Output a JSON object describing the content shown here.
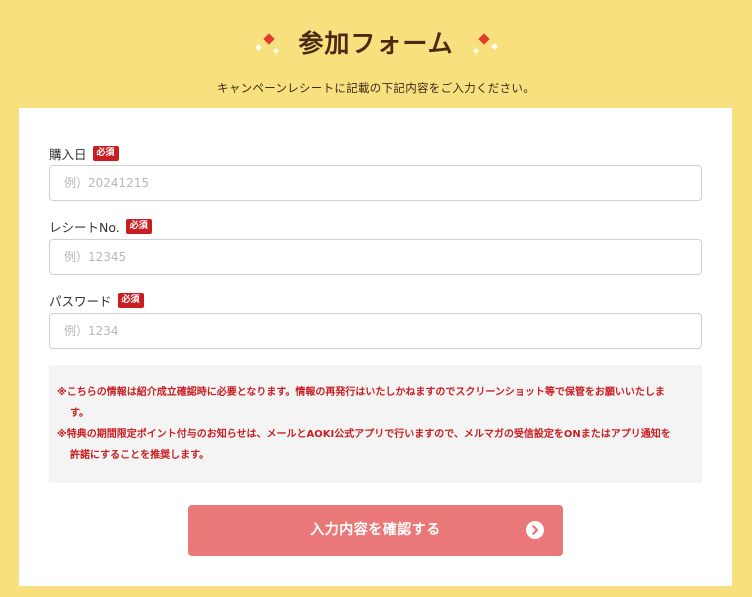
{
  "header": {
    "title": "参加フォーム",
    "subtitle": "キャンペーンレシートに記載の下記内容をご入力ください。"
  },
  "form": {
    "required_badge": "必須",
    "fields": [
      {
        "label": "購入日",
        "placeholder": "例）20241215",
        "value": ""
      },
      {
        "label": "レシートNo.",
        "placeholder": "例）12345",
        "value": ""
      },
      {
        "label": "パスワード",
        "placeholder": "例）1234",
        "value": ""
      }
    ],
    "notes": [
      "※こちらの情報は紹介成立確認時に必要となります。情報の再発行はいたしかねますのでスクリーンショット等で保管をお願いいたします。",
      "※特典の期間限定ポイント付与のお知らせは、メールとAOKI公式アプリで行いますので、メルマガの受信設定をONまたはアプリ通知を許諾にすることを推奨します。"
    ],
    "submit_label": "入力内容を確認する"
  },
  "colors": {
    "background": "#f8e07f",
    "title": "#4a2a14",
    "badge": "#c81e22",
    "note_text": "#c81e22",
    "button": "#eb7878"
  },
  "icons": {
    "title_left": "sparkle-decoration-icon",
    "title_right": "sparkle-decoration-icon",
    "submit": "arrow-circle-right-icon"
  }
}
